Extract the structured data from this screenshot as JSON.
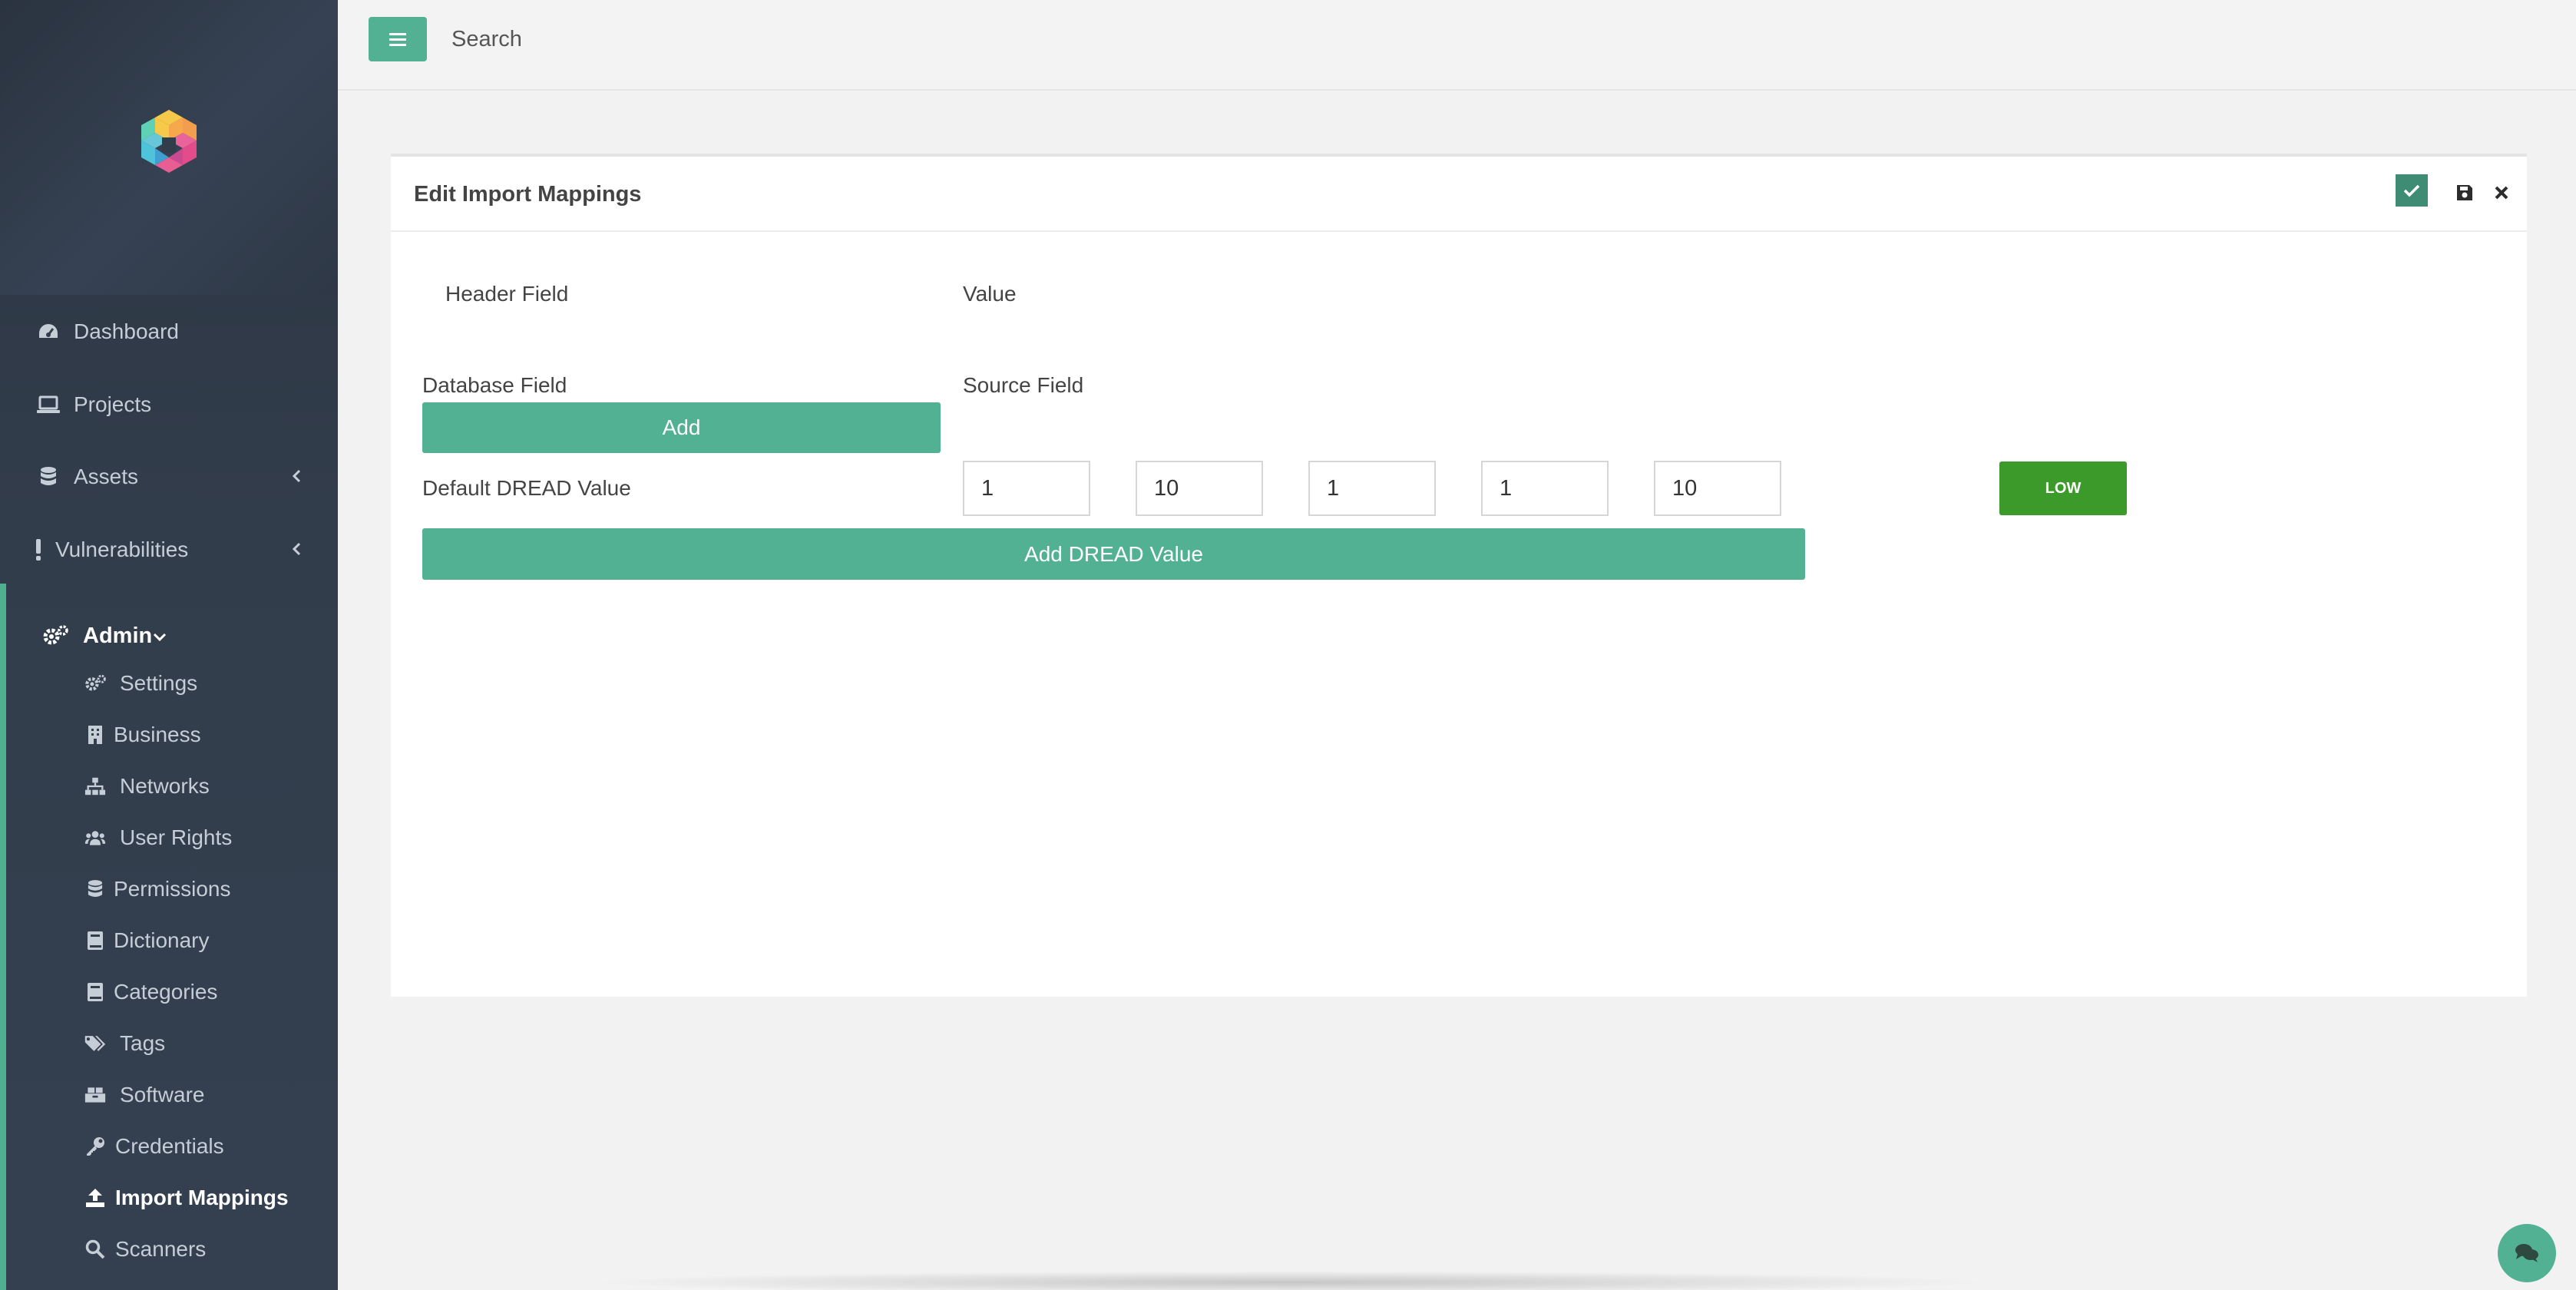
{
  "topbar": {
    "search_placeholder": "Search"
  },
  "sidebar": {
    "items": [
      {
        "label": "Dashboard",
        "icon": "gauge-icon"
      },
      {
        "label": "Projects",
        "icon": "laptop-icon"
      },
      {
        "label": "Assets",
        "icon": "database-icon"
      },
      {
        "label": "Vulnerabilities",
        "icon": "exclamation-icon"
      }
    ],
    "admin": {
      "label": "Admin",
      "icon": "cogs-icon",
      "subitems": [
        {
          "label": "Settings",
          "icon": "cogs-icon"
        },
        {
          "label": "Business",
          "icon": "building-icon"
        },
        {
          "label": "Networks",
          "icon": "sitemap-icon"
        },
        {
          "label": "User Rights",
          "icon": "users-icon"
        },
        {
          "label": "Permissions",
          "icon": "database-icon"
        },
        {
          "label": "Dictionary",
          "icon": "book-icon"
        },
        {
          "label": "Categories",
          "icon": "book-icon"
        },
        {
          "label": "Tags",
          "icon": "tags-icon"
        },
        {
          "label": "Software",
          "icon": "boxes-icon"
        },
        {
          "label": "Credentials",
          "icon": "key-icon"
        },
        {
          "label": "Import Mappings",
          "icon": "upload-icon"
        },
        {
          "label": "Scanners",
          "icon": "search-icon"
        }
      ],
      "active": "Import Mappings"
    }
  },
  "panel": {
    "title": "Edit Import Mappings",
    "header_field_label": "Header Field",
    "value_label": "Value",
    "database_field_label": "Database Field",
    "source_field_label": "Source Field",
    "add_label": "Add",
    "default_dread_label": "Default DREAD Value",
    "dread_values": [
      "1",
      "10",
      "1",
      "1",
      "10"
    ],
    "risk_label": "LOW",
    "add_dread_label": "Add DREAD Value"
  },
  "colors": {
    "accent": "#52b193",
    "low": "#3c9a2b",
    "sidebar": "#323d4b"
  }
}
